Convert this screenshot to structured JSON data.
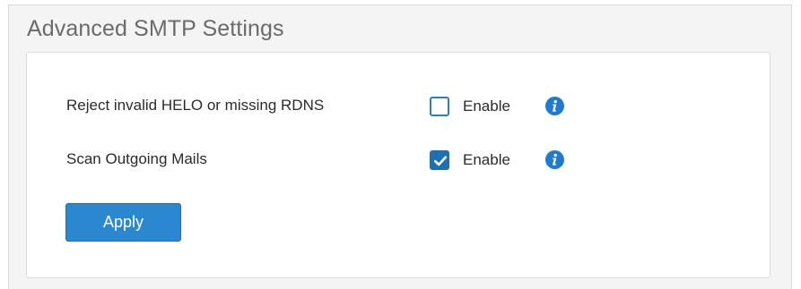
{
  "panel": {
    "title": "Advanced SMTP Settings"
  },
  "settings": [
    {
      "label": "Reject invalid HELO or missing RDNS",
      "option_label": "Enable",
      "checked": false
    },
    {
      "label": "Scan Outgoing Mails",
      "option_label": "Enable",
      "checked": true
    }
  ],
  "actions": {
    "apply_label": "Apply"
  },
  "icons": {
    "info": "info-icon",
    "check": "checkmark-icon"
  },
  "colors": {
    "accent": "#2a87d0",
    "checkbox_checked": "#1f6fb5",
    "info_icon": "#1f7ad0",
    "panel_background": "#f4f4f4",
    "title_text": "#6b6b6b"
  }
}
